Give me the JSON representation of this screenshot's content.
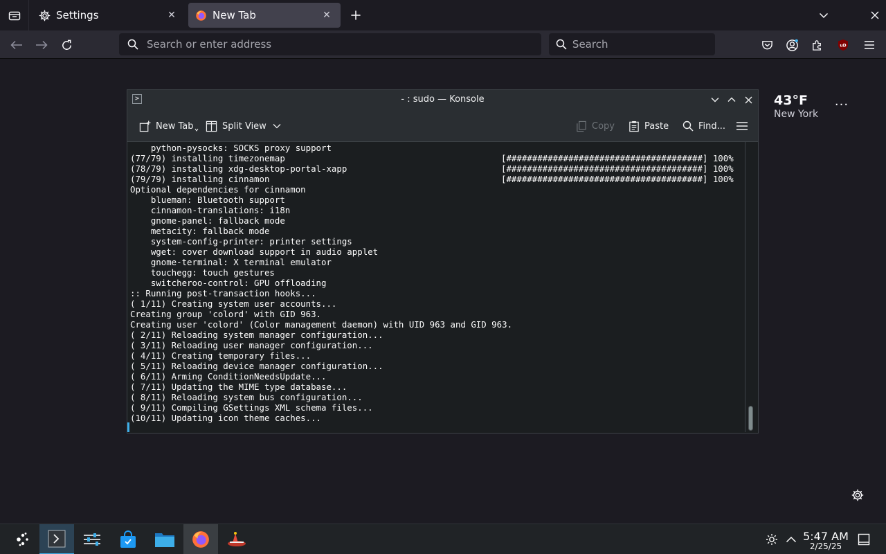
{
  "browser": {
    "tabs": [
      {
        "title": "Settings",
        "active": false
      },
      {
        "title": "New Tab",
        "active": true
      }
    ],
    "urlbar": {
      "placeholder": "Search or enter address"
    },
    "searchbar": {
      "placeholder": "Search"
    }
  },
  "newtab": {
    "weather": {
      "temperature": "43°F",
      "city": "New York"
    },
    "more_label": "..."
  },
  "konsole": {
    "title": "- : sudo — Konsole",
    "toolbar": {
      "new_tab": "New Tab",
      "split_view": "Split View",
      "copy": "Copy",
      "paste": "Paste",
      "find": "Find..."
    },
    "lines": [
      {
        "text": "    python-pysocks: SOCKS proxy support",
        "progress": ""
      },
      {
        "text": "(77/79) installing timezonemap",
        "progress": "[######################################] 100%"
      },
      {
        "text": "(78/79) installing xdg-desktop-portal-xapp",
        "progress": "[######################################] 100%"
      },
      {
        "text": "(79/79) installing cinnamon",
        "progress": "[######################################] 100%"
      },
      {
        "text": "Optional dependencies for cinnamon",
        "progress": ""
      },
      {
        "text": "    blueman: Bluetooth support",
        "progress": ""
      },
      {
        "text": "    cinnamon-translations: i18n",
        "progress": ""
      },
      {
        "text": "    gnome-panel: fallback mode",
        "progress": ""
      },
      {
        "text": "    metacity: fallback mode",
        "progress": ""
      },
      {
        "text": "    system-config-printer: printer settings",
        "progress": ""
      },
      {
        "text": "    wget: cover download support in audio applet",
        "progress": ""
      },
      {
        "text": "    gnome-terminal: X terminal emulator",
        "progress": ""
      },
      {
        "text": "    touchegg: touch gestures",
        "progress": ""
      },
      {
        "text": "    switcheroo-control: GPU offloading",
        "progress": ""
      },
      {
        "text": ":: Running post-transaction hooks...",
        "progress": ""
      },
      {
        "text": "( 1/11) Creating system user accounts...",
        "progress": ""
      },
      {
        "text": "Creating group 'colord' with GID 963.",
        "progress": ""
      },
      {
        "text": "Creating user 'colord' (Color management daemon) with UID 963 and GID 963.",
        "progress": ""
      },
      {
        "text": "( 2/11) Reloading system manager configuration...",
        "progress": ""
      },
      {
        "text": "( 3/11) Reloading user manager configuration...",
        "progress": ""
      },
      {
        "text": "( 4/11) Creating temporary files...",
        "progress": ""
      },
      {
        "text": "( 5/11) Reloading device manager configuration...",
        "progress": ""
      },
      {
        "text": "( 6/11) Arming ConditionNeedsUpdate...",
        "progress": ""
      },
      {
        "text": "( 7/11) Updating the MIME type database...",
        "progress": ""
      },
      {
        "text": "( 8/11) Reloading system bus configuration...",
        "progress": ""
      },
      {
        "text": "( 9/11) Compiling GSettings XML schema files...",
        "progress": ""
      },
      {
        "text": "(10/11) Updating icon theme caches...",
        "progress": ""
      }
    ]
  },
  "taskbar": {
    "clock": {
      "time": "5:47 AM",
      "date": "2/25/25"
    }
  },
  "colors": {
    "accent": "#3daee9",
    "firefox_bg": "#1c1b22",
    "toolbar_bg": "#2b2a33",
    "terminal_bg": "#1b1e20"
  }
}
